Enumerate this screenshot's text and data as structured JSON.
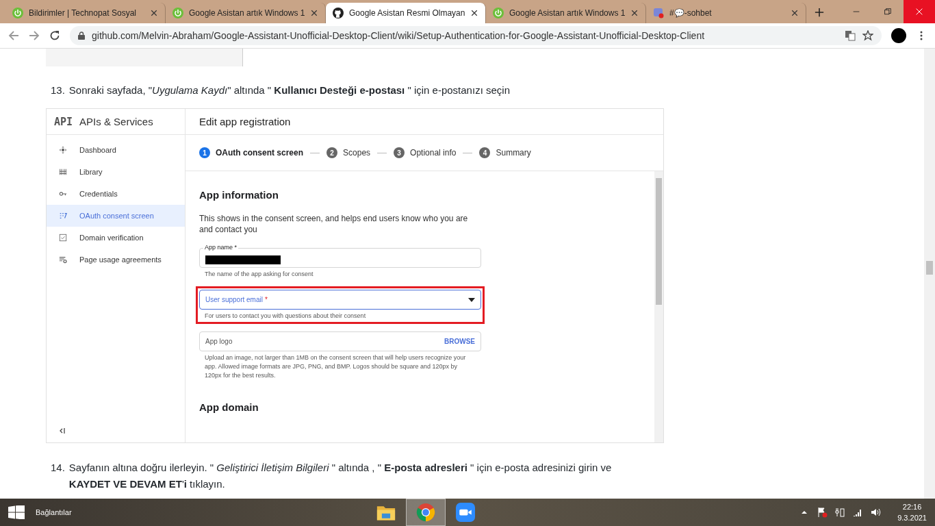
{
  "browser": {
    "tabs": [
      {
        "title": "Bildirimler | Technopat Sosyal",
        "selected": false
      },
      {
        "title": "Google Asistan artık Windows 1",
        "selected": false
      },
      {
        "title": "Google Asistan Resmi Olmayan",
        "selected": true
      },
      {
        "title": "Google Asistan artık Windows 1",
        "selected": false
      },
      {
        "title": "#💬-sohbet",
        "selected": false
      }
    ],
    "url": "github.com/Melvin-Abraham/Google-Assistant-Unofficial-Desktop-Client/wiki/Setup-Authentication-for-Google-Assistant-Unofficial-Desktop-Client"
  },
  "article": {
    "steps": [
      {
        "number": "13.",
        "text": "Sonraki sayfada, \"*Uygulama Kaydı*\" altında \" **Kullanıcı Desteği e-postası** \" için e-postanızı seçin"
      },
      {
        "number": "14.",
        "text": "Sayfanın altına doğru ilerleyin. \" *Geliştirici İletişim Bilgileri* \" altında , \" **E-posta adresleri** \" için e-posta adresinizi girin ve **KAYDET VE DEVAM ET**'**i** tıklayın."
      }
    ]
  },
  "console": {
    "logo": "API",
    "title": "APIs & Services",
    "nav": [
      {
        "label": "Dashboard",
        "selected": false
      },
      {
        "label": "Library",
        "selected": false
      },
      {
        "label": "Credentials",
        "selected": false
      },
      {
        "label": "OAuth consent screen",
        "selected": true
      },
      {
        "label": "Domain verification",
        "selected": false
      },
      {
        "label": "Page usage agreements",
        "selected": false
      }
    ],
    "header": "Edit app registration",
    "stepper": [
      {
        "number": "1",
        "label": "OAuth consent screen",
        "selected": true
      },
      {
        "number": "2",
        "label": "Scopes",
        "selected": false
      },
      {
        "number": "3",
        "label": "Optional info",
        "selected": false
      },
      {
        "number": "4",
        "label": "Summary",
        "selected": false
      }
    ],
    "section": "App information",
    "description": "This shows in the consent screen, and helps end users know who you are and contact you",
    "fields": [
      {
        "kind": "text",
        "label": "App name *",
        "helper": "The name of the app asking for consent",
        "highlighted": false
      },
      {
        "kind": "select",
        "placeholder": "User support email",
        "required_mark": "*",
        "helper": "For users to contact you with questions about their consent",
        "highlighted": true
      },
      {
        "kind": "file",
        "placeholder": "App logo",
        "button": "BROWSE",
        "helper": "Upload an image, not larger than 1MB on the consent screen that will help users recognize your app. Allowed image formats are JPG, PNG, and BMP. Logos should be square and 120px by 120px for the best results.",
        "highlighted": false
      }
    ],
    "next_section": "App domain"
  },
  "taskbar": {
    "links_label": "Bağlantılar",
    "apps": [
      {
        "selected": false
      },
      {
        "selected": true
      },
      {
        "selected": false
      }
    ],
    "time": "22:16",
    "date": "9.3.2021"
  }
}
